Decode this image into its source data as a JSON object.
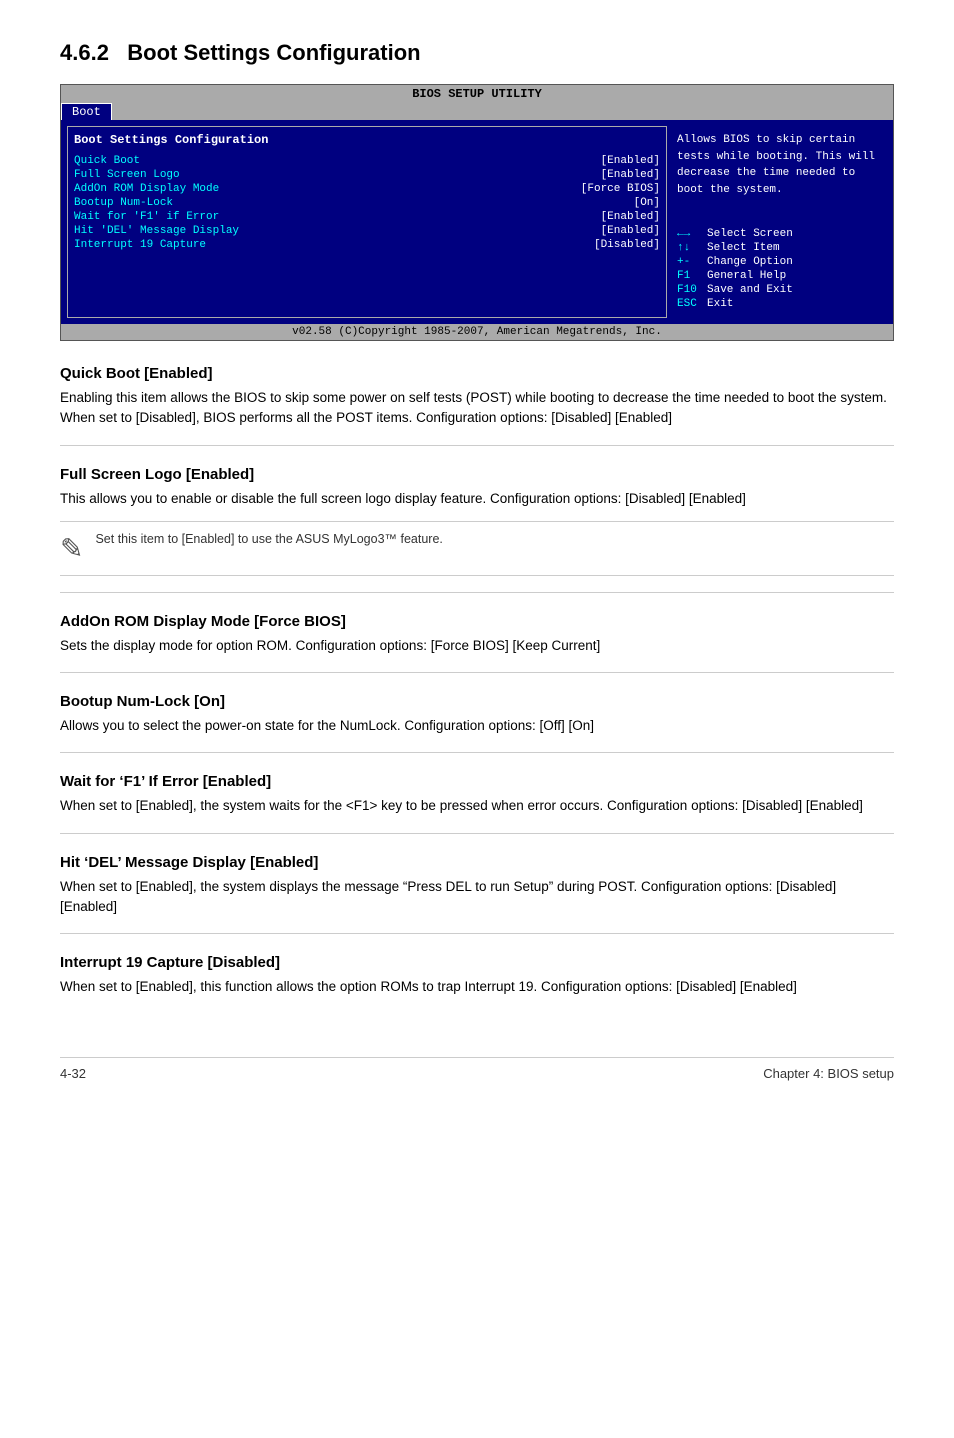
{
  "page": {
    "section_number": "4.6.2",
    "section_title": "Boot Settings Configuration"
  },
  "bios": {
    "header": "BIOS SETUP UTILITY",
    "active_tab": "Boot",
    "left_panel_title": "Boot Settings Configuration",
    "items": [
      {
        "label": "Quick Boot",
        "value": "[Enabled]"
      },
      {
        "label": "Full Screen Logo",
        "value": "[Enabled]"
      },
      {
        "label": "AddOn ROM Display Mode",
        "value": "[Force BIOS]"
      },
      {
        "label": "Bootup Num-Lock",
        "value": "[On]"
      },
      {
        "label": "Wait for 'F1' if Error",
        "value": "[Enabled]"
      },
      {
        "label": "Hit 'DEL' Message Display",
        "value": "[Enabled]"
      },
      {
        "label": "Interrupt 19 Capture",
        "value": "[Disabled]"
      }
    ],
    "help_text": "Allows BIOS to skip certain tests while booting. This will decrease the time needed to boot the system.",
    "keys": [
      {
        "symbol": "←→",
        "action": "Select Screen"
      },
      {
        "symbol": "↑↓",
        "action": "Select Item"
      },
      {
        "symbol": "+-",
        "action": "Change Option"
      },
      {
        "symbol": "F1",
        "action": "General Help"
      },
      {
        "symbol": "F10",
        "action": "Save and Exit"
      },
      {
        "symbol": "ESC",
        "action": "Exit"
      }
    ],
    "footer": "v02.58 (C)Copyright 1985-2007, American Megatrends, Inc."
  },
  "sections": [
    {
      "id": "quick-boot",
      "heading": "Quick Boot [Enabled]",
      "body": "Enabling this item allows the BIOS to skip some power on self tests (POST) while booting to decrease the time needed to boot the system. When set to [Disabled], BIOS performs all the POST items. Configuration options: [Disabled] [Enabled]"
    },
    {
      "id": "full-screen-logo",
      "heading": "Full Screen Logo [Enabled]",
      "body": "This allows you to enable or disable the full screen logo display feature. Configuration options: [Disabled] [Enabled]",
      "note": "Set this item to [Enabled] to use the ASUS MyLogo3™ feature."
    },
    {
      "id": "addon-rom",
      "heading": "AddOn ROM Display Mode [Force BIOS]",
      "body": "Sets the display mode for option ROM. Configuration options: [Force BIOS] [Keep Current]"
    },
    {
      "id": "bootup-numlock",
      "heading": "Bootup Num-Lock [On]",
      "body": "Allows you to select the power-on state for the NumLock. Configuration options: [Off] [On]"
    },
    {
      "id": "wait-f1",
      "heading": "Wait for ‘F1’ If Error [Enabled]",
      "body": "When set to [Enabled], the system waits for the <F1> key to be pressed when error occurs. Configuration options: [Disabled] [Enabled]"
    },
    {
      "id": "hit-del",
      "heading": "Hit ‘DEL’ Message Display [Enabled]",
      "body": "When set to [Enabled], the system displays the message “Press DEL to run Setup” during POST. Configuration options: [Disabled] [Enabled]"
    },
    {
      "id": "interrupt-19",
      "heading": "Interrupt 19 Capture [Disabled]",
      "body": "When set to [Enabled], this function allows the option ROMs to trap Interrupt 19. Configuration options: [Disabled] [Enabled]"
    }
  ],
  "footer": {
    "left": "4-32",
    "right": "Chapter 4: BIOS setup"
  }
}
